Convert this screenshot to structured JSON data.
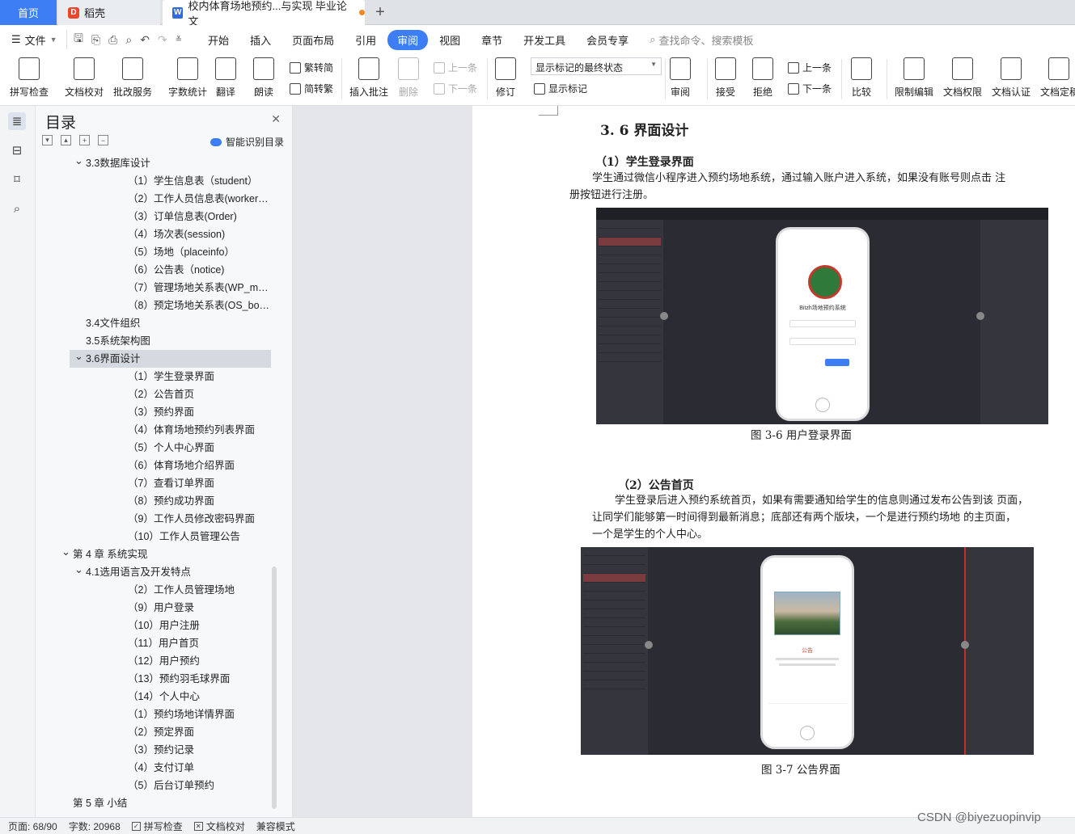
{
  "tabs": {
    "home": "首页",
    "daoke": "稻壳",
    "doc": "校内体育场地预约...与实现 毕业论文",
    "add": "+"
  },
  "menu": {
    "file": "文件",
    "items": [
      "开始",
      "插入",
      "页面布局",
      "引用",
      "审阅",
      "视图",
      "章节",
      "开发工具",
      "会员专享"
    ],
    "search": "查找命令、搜索模板"
  },
  "ribbon": {
    "spell": "拼写检查",
    "proof": "文档校对",
    "batch": "批改服务",
    "wordcount": "字数统计",
    "translate": "翻译",
    "read": "朗读",
    "to_trad": "繁转简",
    "to_simp": "简转繁",
    "insert_comment": "插入批注",
    "delete": "删除",
    "prev": "上一条",
    "next": "下一条",
    "revise": "修订",
    "display_select": "显示标记的最终状态",
    "show_marks": "显示标记",
    "review": "审阅",
    "accept": "接受",
    "reject": "拒绝",
    "prev2": "上一条",
    "next2": "下一条",
    "compare": "比较",
    "restrict": "限制编辑",
    "permission": "文档权限",
    "certify": "文档认证",
    "finalize": "文档定稿"
  },
  "toc": {
    "title": "目录",
    "ai_label": "智能识别目录",
    "items": [
      {
        "text": "3.3数据库设计",
        "level": 2,
        "arrow": true
      },
      {
        "text": "（1）学生信息表（student）",
        "level": 3
      },
      {
        "text": "（2）工作人员信息表(worker…",
        "level": 3
      },
      {
        "text": "（3）订单信息表(Order)",
        "level": 3
      },
      {
        "text": "（4）场次表(session)",
        "level": 3
      },
      {
        "text": "（5）场地（placeinfo）",
        "level": 3
      },
      {
        "text": "（6）公告表（notice)",
        "level": 3
      },
      {
        "text": "（7）管理场地关系表(WP_ma…",
        "level": 3
      },
      {
        "text": "（8）预定场地关系表(OS_bo…",
        "level": 3
      },
      {
        "text": "3.4文件组织",
        "level": 2
      },
      {
        "text": "3.5系统架构图",
        "level": 2
      },
      {
        "text": "3.6界面设计",
        "level": 2,
        "arrow": true,
        "selected": true
      },
      {
        "text": "（1）学生登录界面",
        "level": 3
      },
      {
        "text": "（2）公告首页",
        "level": 3
      },
      {
        "text": "（3）预约界面",
        "level": 3
      },
      {
        "text": "（4）体育场地预约列表界面",
        "level": 3
      },
      {
        "text": "（5）个人中心界面",
        "level": 3
      },
      {
        "text": "（6）体育场地介绍界面",
        "level": 3
      },
      {
        "text": "（7）查看订单界面",
        "level": 3
      },
      {
        "text": "（8）预约成功界面",
        "level": 3
      },
      {
        "text": "（9）工作人员修改密码界面",
        "level": 3
      },
      {
        "text": "（10）工作人员管理公告",
        "level": 3
      },
      {
        "text": "第 4 章 系统实现",
        "level": 1,
        "arrow": true
      },
      {
        "text": "4.1选用语言及开发特点",
        "level": 2,
        "arrow": true
      },
      {
        "text": "（2）工作人员管理场地",
        "level": 3
      },
      {
        "text": "（9）用户登录",
        "level": 3
      },
      {
        "text": "（10）用户注册",
        "level": 3
      },
      {
        "text": "（11）用户首页",
        "level": 3
      },
      {
        "text": "（12）用户预约",
        "level": 3
      },
      {
        "text": "（13）预约羽毛球界面",
        "level": 3
      },
      {
        "text": "（14）个人中心",
        "level": 3
      },
      {
        "text": "（1）预约场地详情界面",
        "level": 3
      },
      {
        "text": "（2）预定界面",
        "level": 3
      },
      {
        "text": "（3）预约记录",
        "level": 3
      },
      {
        "text": "（4）支付订单",
        "level": 3
      },
      {
        "text": "（5）后台订单预约",
        "level": 3
      },
      {
        "text": "第 5 章 小结",
        "level": 1
      }
    ]
  },
  "doc": {
    "section_title": "3. 6 界面设计",
    "h_login": "（1）学生登录界面",
    "p_login_1": "学生通过微信小程序进入预约场地系统，通过输入账户进入系统，如果没有账号则点击  注",
    "p_login_2": "册按钮进行注册。",
    "fig1_caption": "图 3-6   用户登录界面",
    "fig1_app_title": "Bitzh场地预约系统",
    "h_notice": "（2）公告首页",
    "p_notice_1": "学生登录后进入预约系统首页，如果有需要通知给学生的信息则通过发布公告到该  页面，",
    "p_notice_2": "让同学们能够第一时间得到最新消息；底部还有两个版块，一个是进行预约场地  的主页面，",
    "p_notice_3": "一个是学生的个人中心。",
    "fig2_caption": "图 3-7   公告界面",
    "fig2_notice_label": "公告"
  },
  "status": {
    "page": "页面: 68/90",
    "words": "字数: 20968",
    "spell": "拼写检查",
    "proof": "文档校对",
    "compat": "兼容模式"
  },
  "watermark": "CSDN @biyezuopinvip",
  "colors": {
    "accent": "#3d7ef5",
    "tab_bar": "#dfe3e8",
    "gap": "#e5e6e9"
  }
}
